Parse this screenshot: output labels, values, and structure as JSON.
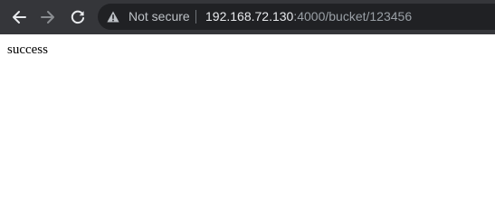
{
  "browser": {
    "nav": {
      "back_icon": "arrow-left-icon",
      "forward_icon": "arrow-right-icon",
      "reload_icon": "reload-icon"
    },
    "address_bar": {
      "security_icon": "warning-triangle-icon",
      "security_label": "Not secure",
      "url_host": "192.168.72.130",
      "url_rest": ":4000/bucket/123456"
    },
    "colors": {
      "toolbar_bg": "#35363a",
      "omnibox_bg": "#202124",
      "url_host": "#e8eaed",
      "url_rest": "#9aa0a6"
    }
  },
  "page": {
    "body_text": "success"
  }
}
